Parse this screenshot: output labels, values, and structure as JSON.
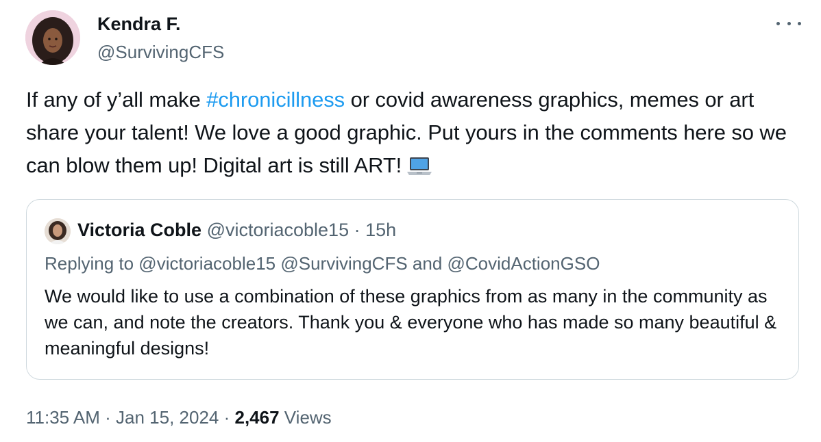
{
  "author": {
    "name": "Kendra F.",
    "handle": "@SurvivingCFS"
  },
  "tweet": {
    "text_before": "If any of y’all make ",
    "hashtag": "#chronicillness",
    "text_after": " or covid awareness graphics, memes or art share your talent! We love a good graphic. Put yours in the comments here so we can blow them up! Digital art is still ART!",
    "emoji": "laptop-emoji"
  },
  "quote": {
    "name": "Victoria Coble",
    "meta": "@victoriacoble15 · 15h",
    "replying": "Replying to @victoriacoble15 @SurvivingCFS and @CovidActionGSO",
    "text": "We would like to use a combination of these graphics from as many in the community as we can, and note the creators. Thank you & everyone who has made so many beautiful & meaningful designs!"
  },
  "footer": {
    "datetime": "11:35 AM · Jan 15, 2024 · ",
    "views_count": "2,467",
    "views_label": "Views"
  },
  "icons": {
    "more": "more-options-icon"
  },
  "colors": {
    "hashtag": "#1d9bf0",
    "secondary_text": "#536471",
    "border": "#cfd9de"
  }
}
